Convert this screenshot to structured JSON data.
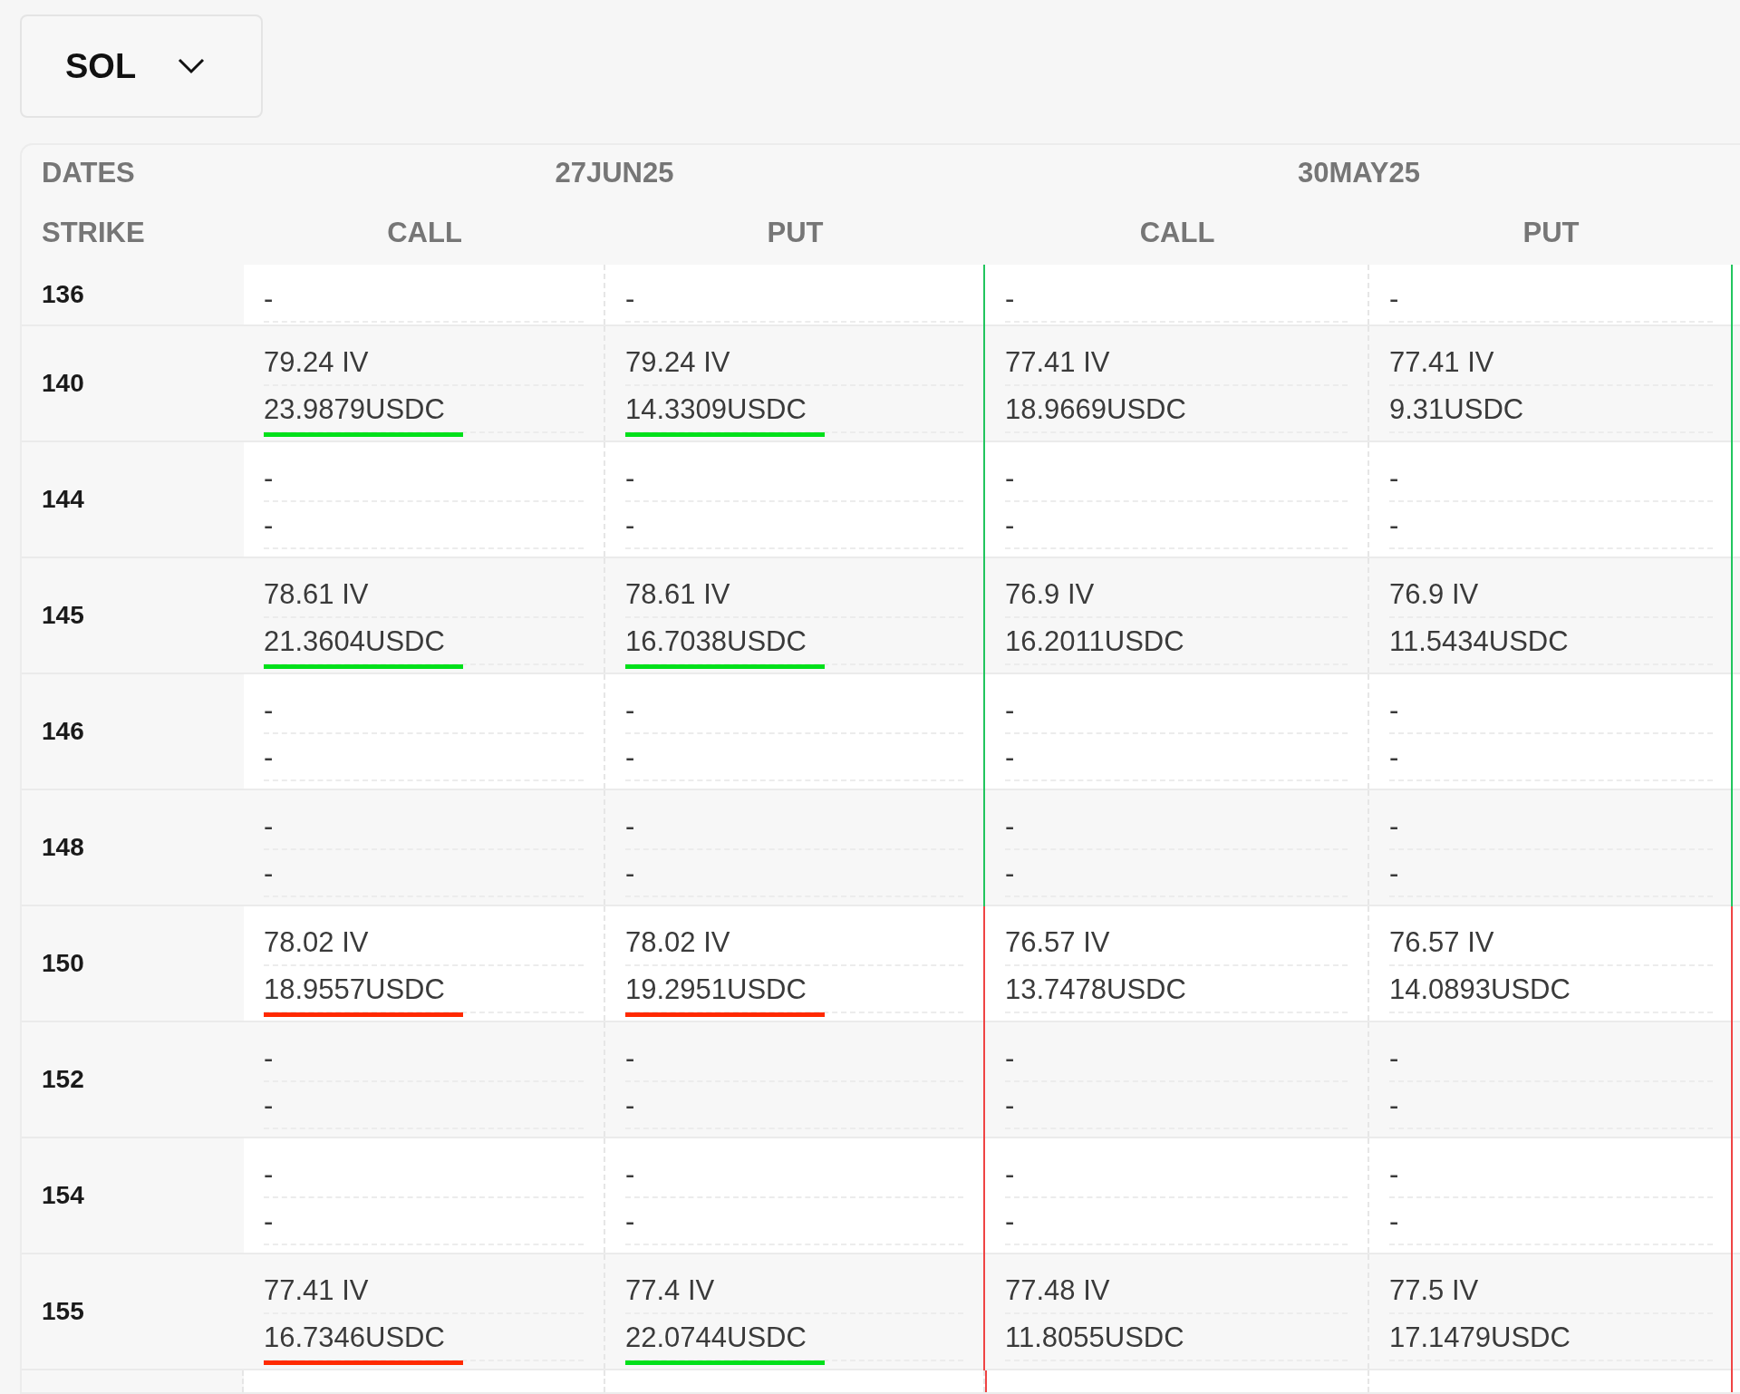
{
  "asset_select": {
    "value": "SOL"
  },
  "header": {
    "dates_label": "DATES",
    "strike_label": "STRIKE",
    "expiries": [
      {
        "date": "27JUN25",
        "columns": [
          "CALL",
          "PUT"
        ]
      },
      {
        "date": "30MAY25",
        "columns": [
          "CALL",
          "PUT"
        ]
      }
    ]
  },
  "rows": [
    {
      "strike": "136",
      "color": "#22c55e",
      "cells": [
        {
          "lines": [
            "-"
          ]
        },
        {
          "lines": [
            "-"
          ]
        },
        {
          "lines": [
            "-"
          ]
        },
        {
          "lines": [
            "-"
          ]
        }
      ]
    },
    {
      "strike": "140",
      "color": "#22c55e",
      "cells": [
        {
          "lines": [
            "79.24 IV",
            "23.9879USDC"
          ],
          "color": "#00e01a"
        },
        {
          "lines": [
            "79.24 IV",
            "14.3309USDC"
          ],
          "color": "#00e01a"
        },
        {
          "lines": [
            "77.41 IV",
            "18.9669USDC"
          ]
        },
        {
          "lines": [
            "77.41 IV",
            "9.31USDC"
          ]
        }
      ]
    },
    {
      "strike": "144",
      "color": "#22c55e",
      "cells": [
        {
          "lines": [
            "-",
            "-"
          ]
        },
        {
          "lines": [
            "-",
            "-"
          ]
        },
        {
          "lines": [
            "-",
            "-"
          ]
        },
        {
          "lines": [
            "-",
            "-"
          ]
        }
      ]
    },
    {
      "strike": "145",
      "color": "#22c55e",
      "cells": [
        {
          "lines": [
            "78.61 IV",
            "21.3604USDC"
          ],
          "color": "#00e01a"
        },
        {
          "lines": [
            "78.61 IV",
            "16.7038USDC"
          ],
          "color": "#00e01a"
        },
        {
          "lines": [
            "76.9 IV",
            "16.2011USDC"
          ]
        },
        {
          "lines": [
            "76.9 IV",
            "11.5434USDC"
          ]
        }
      ]
    },
    {
      "strike": "146",
      "color": "#22c55e",
      "cells": [
        {
          "lines": [
            "-",
            "-"
          ]
        },
        {
          "lines": [
            "-",
            "-"
          ]
        },
        {
          "lines": [
            "-",
            "-"
          ]
        },
        {
          "lines": [
            "-",
            "-"
          ]
        }
      ]
    },
    {
      "strike": "148",
      "color": "#22c55e",
      "cells": [
        {
          "lines": [
            "-",
            "-"
          ]
        },
        {
          "lines": [
            "-",
            "-"
          ]
        },
        {
          "lines": [
            "-",
            "-"
          ]
        },
        {
          "lines": [
            "-",
            "-"
          ]
        }
      ]
    },
    {
      "strike": "150",
      "color": "#ef4444",
      "cells": [
        {
          "lines": [
            "78.02 IV",
            "18.9557USDC"
          ],
          "color": "#ff2a00"
        },
        {
          "lines": [
            "78.02 IV",
            "19.2951USDC"
          ],
          "color": "#ff2a00"
        },
        {
          "lines": [
            "76.57 IV",
            "13.7478USDC"
          ]
        },
        {
          "lines": [
            "76.57 IV",
            "14.0893USDC"
          ]
        }
      ]
    },
    {
      "strike": "152",
      "color": "#ef4444",
      "cells": [
        {
          "lines": [
            "-",
            "-"
          ]
        },
        {
          "lines": [
            "-",
            "-"
          ]
        },
        {
          "lines": [
            "-",
            "-"
          ]
        },
        {
          "lines": [
            "-",
            "-"
          ]
        }
      ]
    },
    {
      "strike": "154",
      "color": "#ef4444",
      "cells": [
        {
          "lines": [
            "-",
            "-"
          ]
        },
        {
          "lines": [
            "-",
            "-"
          ]
        },
        {
          "lines": [
            "-",
            "-"
          ]
        },
        {
          "lines": [
            "-",
            "-"
          ]
        }
      ]
    },
    {
      "strike": "155",
      "color": "#ef4444",
      "cells": [
        {
          "lines": [
            "77.41 IV",
            "16.7346USDC"
          ],
          "color": "#ff2a00"
        },
        {
          "lines": [
            "77.4 IV",
            "22.0744USDC"
          ],
          "color": "#00e01a"
        },
        {
          "lines": [
            "77.48 IV",
            "11.8055USDC"
          ]
        },
        {
          "lines": [
            "77.5 IV",
            "17.1479USDC"
          ]
        }
      ]
    }
  ]
}
